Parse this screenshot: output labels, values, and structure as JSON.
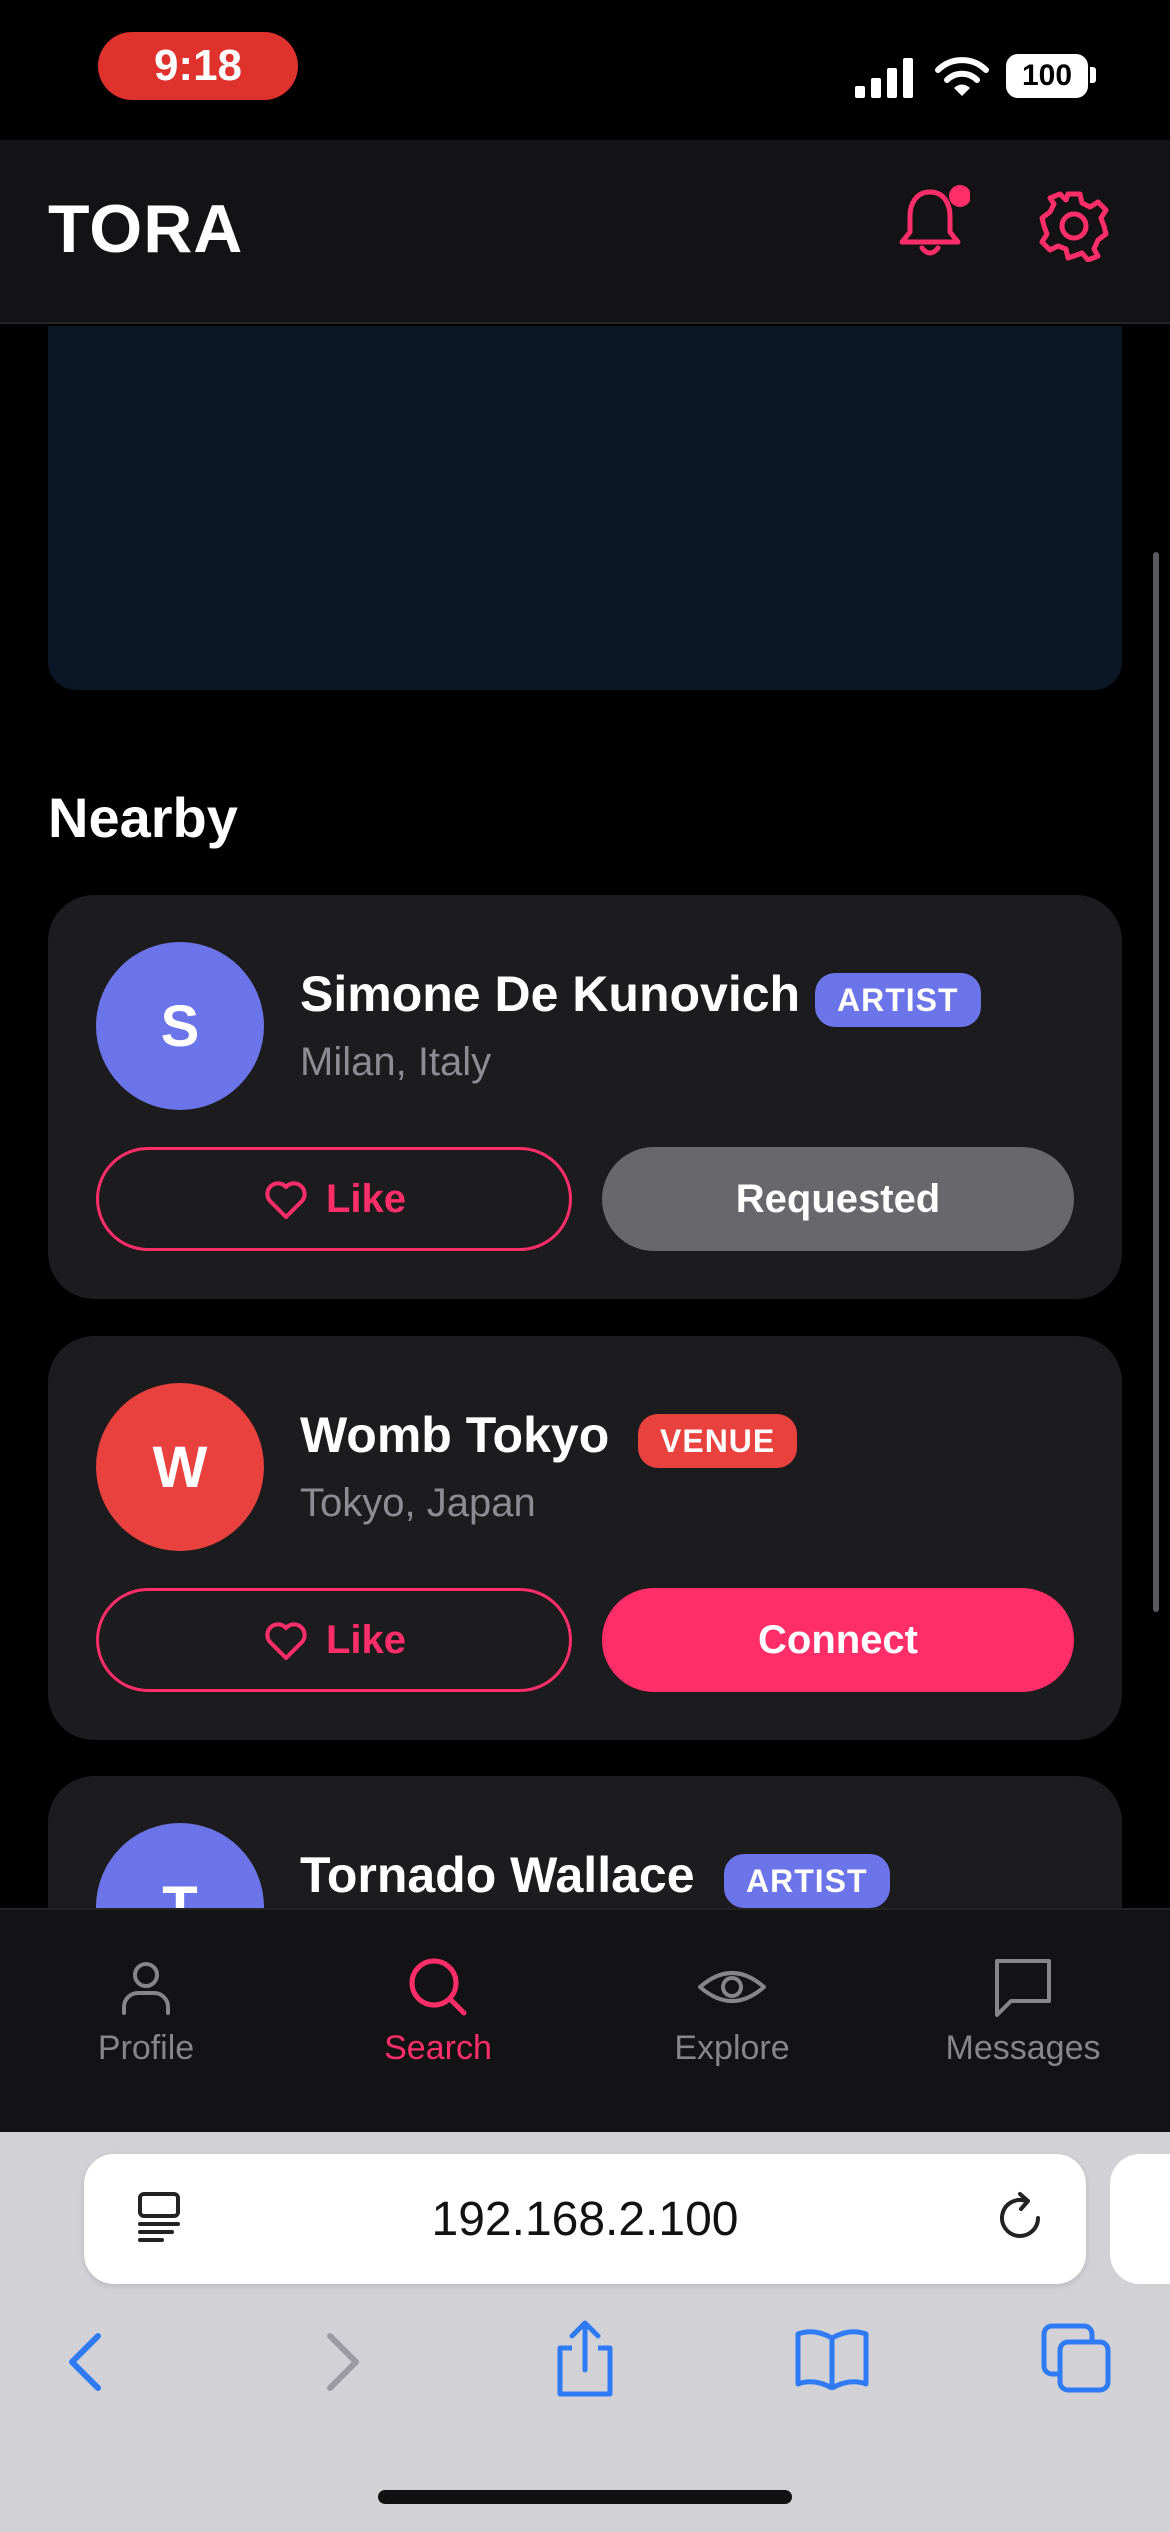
{
  "status_bar": {
    "time": "9:18",
    "battery": "100"
  },
  "header": {
    "logo": "TORA"
  },
  "section": {
    "title": "Nearby"
  },
  "cards": [
    {
      "initial": "S",
      "name": "Simone De Kunovich",
      "badge": "ARTIST",
      "location": "Milan, Italy",
      "like_label": "Like",
      "action_label": "Requested"
    },
    {
      "initial": "W",
      "name": "Womb Tokyo",
      "badge": "VENUE",
      "location": "Tokyo, Japan",
      "like_label": "Like",
      "action_label": "Connect"
    },
    {
      "initial": "T",
      "name": "Tornado Wallace",
      "badge": "ARTIST"
    }
  ],
  "nav": [
    {
      "label": "Profile",
      "icon": "person-icon"
    },
    {
      "label": "Search",
      "icon": "search-icon"
    },
    {
      "label": "Explore",
      "icon": "eye-icon"
    },
    {
      "label": "Messages",
      "icon": "chat-icon"
    }
  ],
  "browser": {
    "url": "192.168.2.100"
  },
  "colors": {
    "accent": "#ff2d68",
    "artist_badge": "#6b74e8",
    "venue_badge": "#e8413e",
    "requested_button": "#68676c",
    "background": "#000000",
    "card": "#1c1b1e"
  }
}
